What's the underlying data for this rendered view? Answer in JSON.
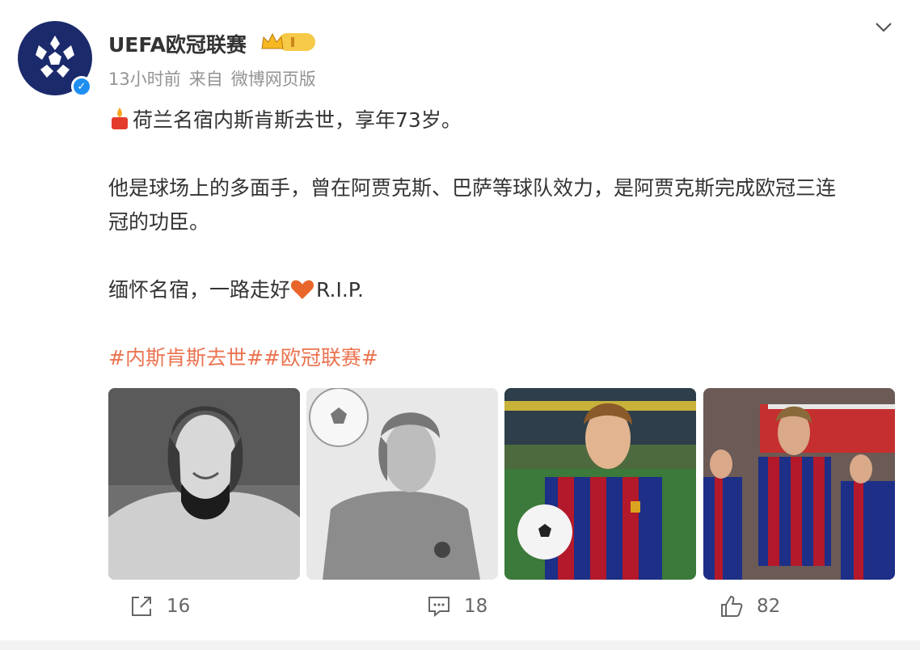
{
  "post": {
    "author": "UEFA欧冠联赛",
    "time": "13小时前",
    "source_prefix": "来自",
    "source": "微博网页版",
    "line1": "荷兰名宿内斯肯斯去世，享年73岁。",
    "line2a": "他是球场上的多面手，曾在阿贾克斯、巴萨等球队效力，是阿贾克斯完成欧冠三连",
    "line2b": "冠的功臣。",
    "line3": "缅怀名宿，一路走好",
    "line3_suffix": "R.I.P.",
    "tags": "#内斯肯斯去世##欧冠联赛#",
    "photos": [
      {
        "desc": "black-and-white portrait smiling"
      },
      {
        "desc": "black-and-white photo with football"
      },
      {
        "desc": "color photo in striped jersey holding ball"
      },
      {
        "desc": "color photo team in striped jerseys"
      }
    ]
  },
  "actions": {
    "share_count": "16",
    "comment_count": "18",
    "like_count": "82"
  },
  "colors": {
    "accent_orange": "#eb7350",
    "verified_blue": "#1f8ef1",
    "meta_gray": "#939393"
  },
  "icons": [
    "ucl-logo",
    "verified-icon",
    "crown-badge-icon",
    "chevron-down-icon",
    "candle-icon",
    "heart-icon",
    "share-icon",
    "comment-icon",
    "like-icon"
  ]
}
